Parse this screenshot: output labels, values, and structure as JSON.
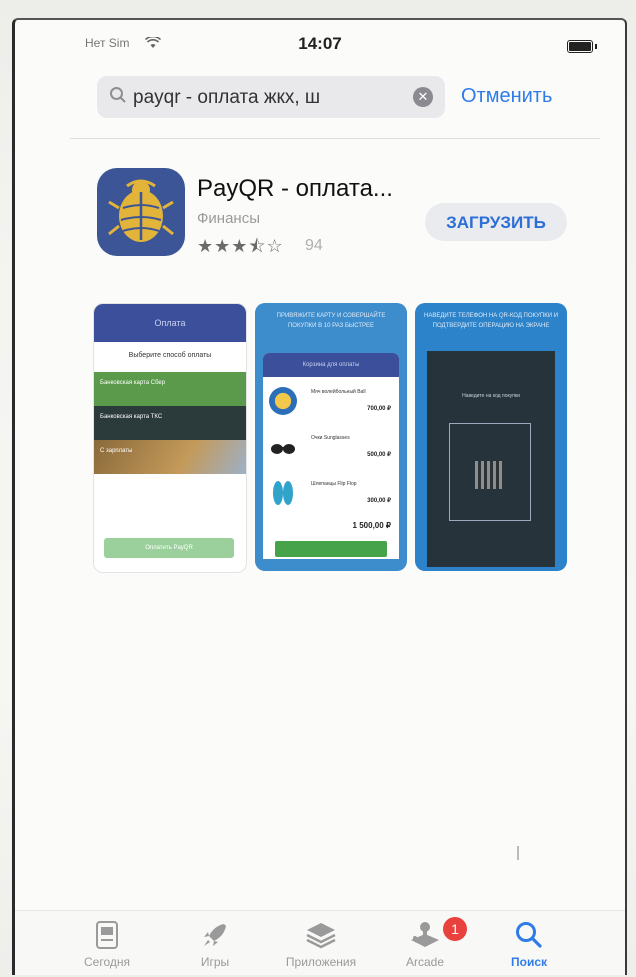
{
  "status_bar": {
    "carrier": "Нет Sim",
    "time": "14:07"
  },
  "search": {
    "query": "payqr - оплата жкх, ш",
    "cancel_label": "Отменить"
  },
  "app": {
    "name": "PayQR - оплата...",
    "category": "Финансы",
    "stars": "★★★⯪☆",
    "rating": 3.5,
    "rating_count": "94",
    "get_label": "ЗАГРУЗИТЬ",
    "icon_color": "#3b5596"
  },
  "screenshots": {
    "shot1": {
      "header": "Оплата",
      "subtitle": "Выберите способ оплаты",
      "card1": "Банковская карта Сбер",
      "card2": "Банковская карта ТКС",
      "card3": "С зарплаты",
      "button": "Оплатить PayQR"
    },
    "shot2": {
      "top": "ПРИВЯЖИТЕ КАРТУ И СОВЕРШАЙТЕ ПОКУПКИ В 10 РАЗ БЫСТРЕЕ",
      "header": "Корзина для оплаты",
      "items": [
        {
          "name": "Мяч волейбольный Ball",
          "price": "700,00 ₽"
        },
        {
          "name": "Очки Sunglasses",
          "price": "500,00 ₽"
        },
        {
          "name": "Шлепанцы Flip Flop",
          "price": "300,00 ₽"
        }
      ],
      "total": "1 500,00 ₽"
    },
    "shot3": {
      "top": "НАВЕДИТЕ ТЕЛЕФОН НА QR-КОД ПОКУПКИ И ПОДТВЕРДИТЕ ОПЕРАЦИЮ НА ЭКРАНЕ",
      "hint": "Наведите на код покупки"
    }
  },
  "tabbar": {
    "today": "Сегодня",
    "games": "Игры",
    "apps": "Приложения",
    "arcade": "Arcade",
    "search": "Поиск",
    "arcade_badge": "1",
    "active_color": "#2f7be8"
  }
}
